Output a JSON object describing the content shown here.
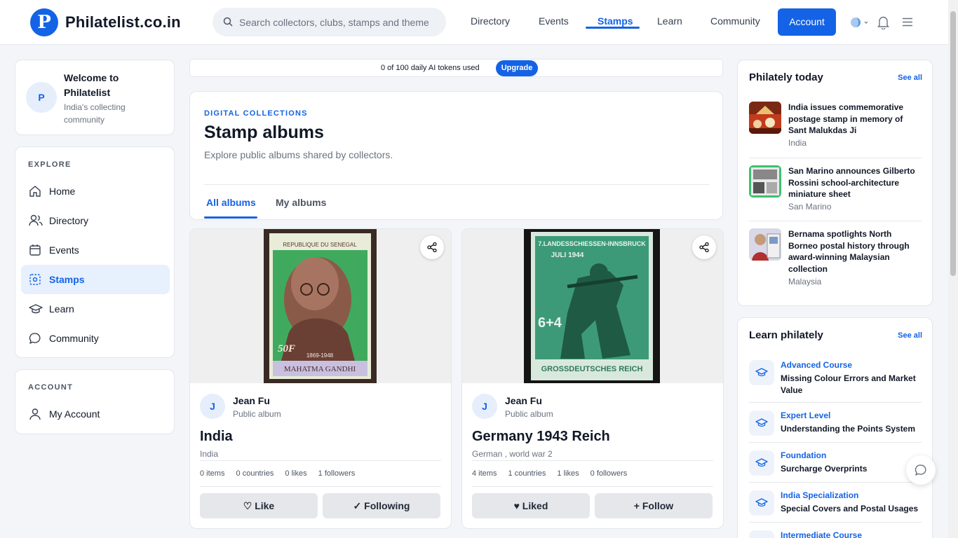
{
  "header": {
    "logo_letter": "P",
    "brand": "Philatelist.co.in",
    "search_placeholder": "Search collectors, clubs, stamps and themes",
    "nav": [
      "Directory",
      "Events",
      "Stamps",
      "Learn",
      "Community"
    ],
    "active_nav": "Stamps",
    "account_label": "Account"
  },
  "sidebar": {
    "welcome_avatar": "P",
    "welcome_title": "Welcome to Philatelist",
    "welcome_sub": "India's collecting community",
    "explore_label": "EXPLORE",
    "items": [
      {
        "label": "Home",
        "icon": "home-icon"
      },
      {
        "label": "Directory",
        "icon": "users-icon"
      },
      {
        "label": "Events",
        "icon": "calendar-icon"
      },
      {
        "label": "Stamps",
        "icon": "stamp-icon"
      },
      {
        "label": "Learn",
        "icon": "graduation-cap-icon"
      },
      {
        "label": "Community",
        "icon": "chat-icon"
      }
    ],
    "account_label": "ACCOUNT",
    "account_item": "My Account"
  },
  "tokens": {
    "text": "0 of 100 daily AI tokens used",
    "upgrade": "Upgrade"
  },
  "main": {
    "eyebrow": "DIGITAL COLLECTIONS",
    "title": "Stamp albums",
    "subtitle": "Explore public albums shared by collectors.",
    "tabs": [
      "All albums",
      "My albums"
    ],
    "albums": [
      {
        "avatar": "J",
        "owner": "Jean Fu",
        "visibility": "Public album",
        "title": "India",
        "description": "India",
        "items": "0 items",
        "countries": "0 countries",
        "likes": "0 likes",
        "followers": "1 followers",
        "like_button": "♡ Like",
        "follow_button": "✓ Following",
        "stamp_top": "REPUBLIQUE DU SENEGAL",
        "stamp_value": "50F",
        "stamp_bottom": "MAHATMA GANDHI",
        "stamp_years": "1869-1948"
      },
      {
        "avatar": "J",
        "owner": "Jean Fu",
        "visibility": "Public album",
        "title": "Germany 1943 Reich",
        "description": "German , world war 2",
        "items": "4 items",
        "countries": "1 countries",
        "likes": "1 likes",
        "followers": "0 followers",
        "like_button": "♥ Liked",
        "follow_button": "+ Follow",
        "stamp_top": "7.LANDESSCHIESSEN-INNSBRUCK",
        "stamp_date": "JULI 1944",
        "stamp_value": "6+4",
        "stamp_bottom": "GROSSDEUTSCHES REICH"
      }
    ]
  },
  "right": {
    "today_title": "Philately today",
    "see_all": "See all",
    "news": [
      {
        "title": "India issues commemorative postage stamp in memory of Sant Malukdas Ji",
        "country": "India"
      },
      {
        "title": "San Marino announces Gilberto Rossini school-architecture miniature sheet",
        "country": "San Marino"
      },
      {
        "title": "Bernama spotlights North Borneo postal history through award-winning Malaysian collection",
        "country": "Malaysia"
      }
    ],
    "learn_title": "Learn philately",
    "learn": [
      {
        "level": "Advanced Course",
        "title": "Missing Colour Errors and Market Value"
      },
      {
        "level": "Expert Level",
        "title": "Understanding the Points System"
      },
      {
        "level": "Foundation",
        "title": "Surcharge Overprints"
      },
      {
        "level": "India Specialization",
        "title": "Special Covers and Postal Usages"
      },
      {
        "level": "Intermediate Course",
        "title": ""
      }
    ]
  },
  "colors": {
    "accent": "#1463e6",
    "stamp_green": "#2f8a69",
    "stamp_brown": "#7a4a3c"
  }
}
